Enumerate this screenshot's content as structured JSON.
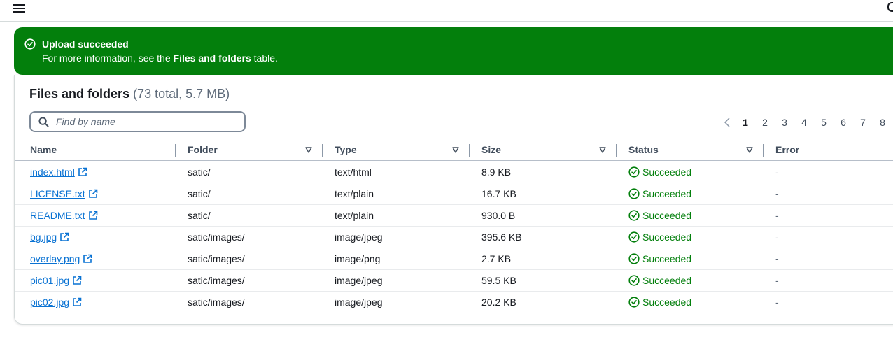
{
  "flash": {
    "title": "Upload succeeded",
    "body_prefix": "For more information, see the ",
    "body_link": "Files and folders",
    "body_suffix": " table."
  },
  "panel": {
    "title": "Files and folders",
    "count": "(73 total, 5.7 MB)"
  },
  "search": {
    "placeholder": "Find by name"
  },
  "pagination": {
    "pages": [
      "1",
      "2",
      "3",
      "4",
      "5",
      "6",
      "7",
      "8"
    ],
    "current": "1"
  },
  "table": {
    "columns": [
      "Name",
      "Folder",
      "Type",
      "Size",
      "Status",
      "Error"
    ],
    "rows": [
      {
        "name": "index.html",
        "folder": "satic/",
        "type": "text/html",
        "size": "8.9 KB",
        "status": "Succeeded",
        "error": "-"
      },
      {
        "name": "LICENSE.txt",
        "folder": "satic/",
        "type": "text/plain",
        "size": "16.7 KB",
        "status": "Succeeded",
        "error": "-"
      },
      {
        "name": "README.txt",
        "folder": "satic/",
        "type": "text/plain",
        "size": "930.0 B",
        "status": "Succeeded",
        "error": "-"
      },
      {
        "name": "bg.jpg",
        "folder": "satic/images/",
        "type": "image/jpeg",
        "size": "395.6 KB",
        "status": "Succeeded",
        "error": "-"
      },
      {
        "name": "overlay.png",
        "folder": "satic/images/",
        "type": "image/png",
        "size": "2.7 KB",
        "status": "Succeeded",
        "error": "-"
      },
      {
        "name": "pic01.jpg",
        "folder": "satic/images/",
        "type": "image/jpeg",
        "size": "59.5 KB",
        "status": "Succeeded",
        "error": "-"
      },
      {
        "name": "pic02.jpg",
        "folder": "satic/images/",
        "type": "image/jpeg",
        "size": "20.2 KB",
        "status": "Succeeded",
        "error": "-"
      }
    ]
  },
  "colors": {
    "success": "#037f0c",
    "link": "#0972d3",
    "text": "#16191f"
  }
}
